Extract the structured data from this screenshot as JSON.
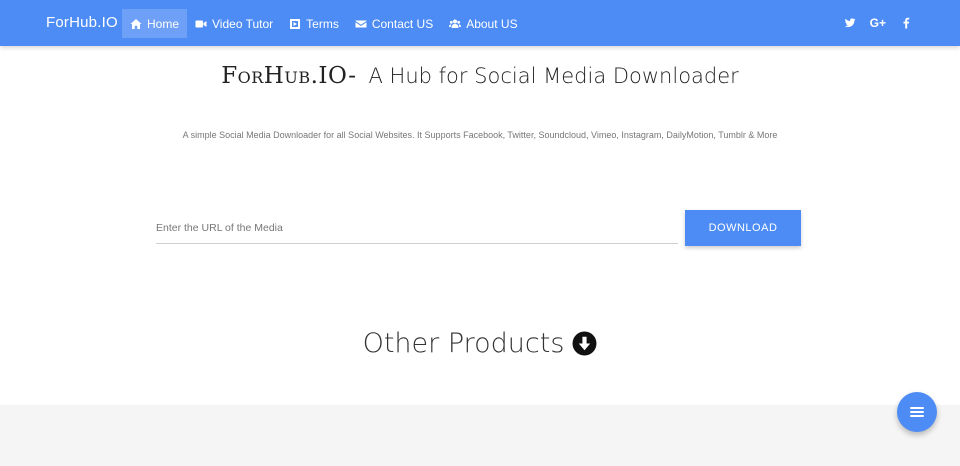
{
  "brand": "ForHub.IO",
  "nav": {
    "items": [
      {
        "label": "Home",
        "icon": "home-icon"
      },
      {
        "label": "Video Tutor",
        "icon": "video-icon"
      },
      {
        "label": "Terms",
        "icon": "play-square-icon"
      },
      {
        "label": "Contact US",
        "icon": "envelope-icon"
      },
      {
        "label": "About US",
        "icon": "users-icon"
      }
    ],
    "active": "Home"
  },
  "social": {
    "twitter": "twitter-icon",
    "google_plus_label": "G+",
    "facebook": "facebook-icon"
  },
  "hero": {
    "logo": "ForHub.IO-",
    "tagline": "A Hub for Social Media Downloader",
    "subtitle": "A simple Social Media Downloader for all Social Websites. It Supports Facebook, Twitter, Soundcloud, Vimeo, Instagram, DailyMotion, Tumblr & More"
  },
  "download_form": {
    "placeholder": "Enter the URL of the Media",
    "value": "",
    "button_label": "DOWNLOAD"
  },
  "other_products": {
    "heading": "Other Products",
    "icon": "arrow-circle-down-icon"
  },
  "fab": {
    "icon": "menu-icon"
  },
  "colors": {
    "primary": "#4d8cf5",
    "footer_band": "#f5f5f5"
  }
}
